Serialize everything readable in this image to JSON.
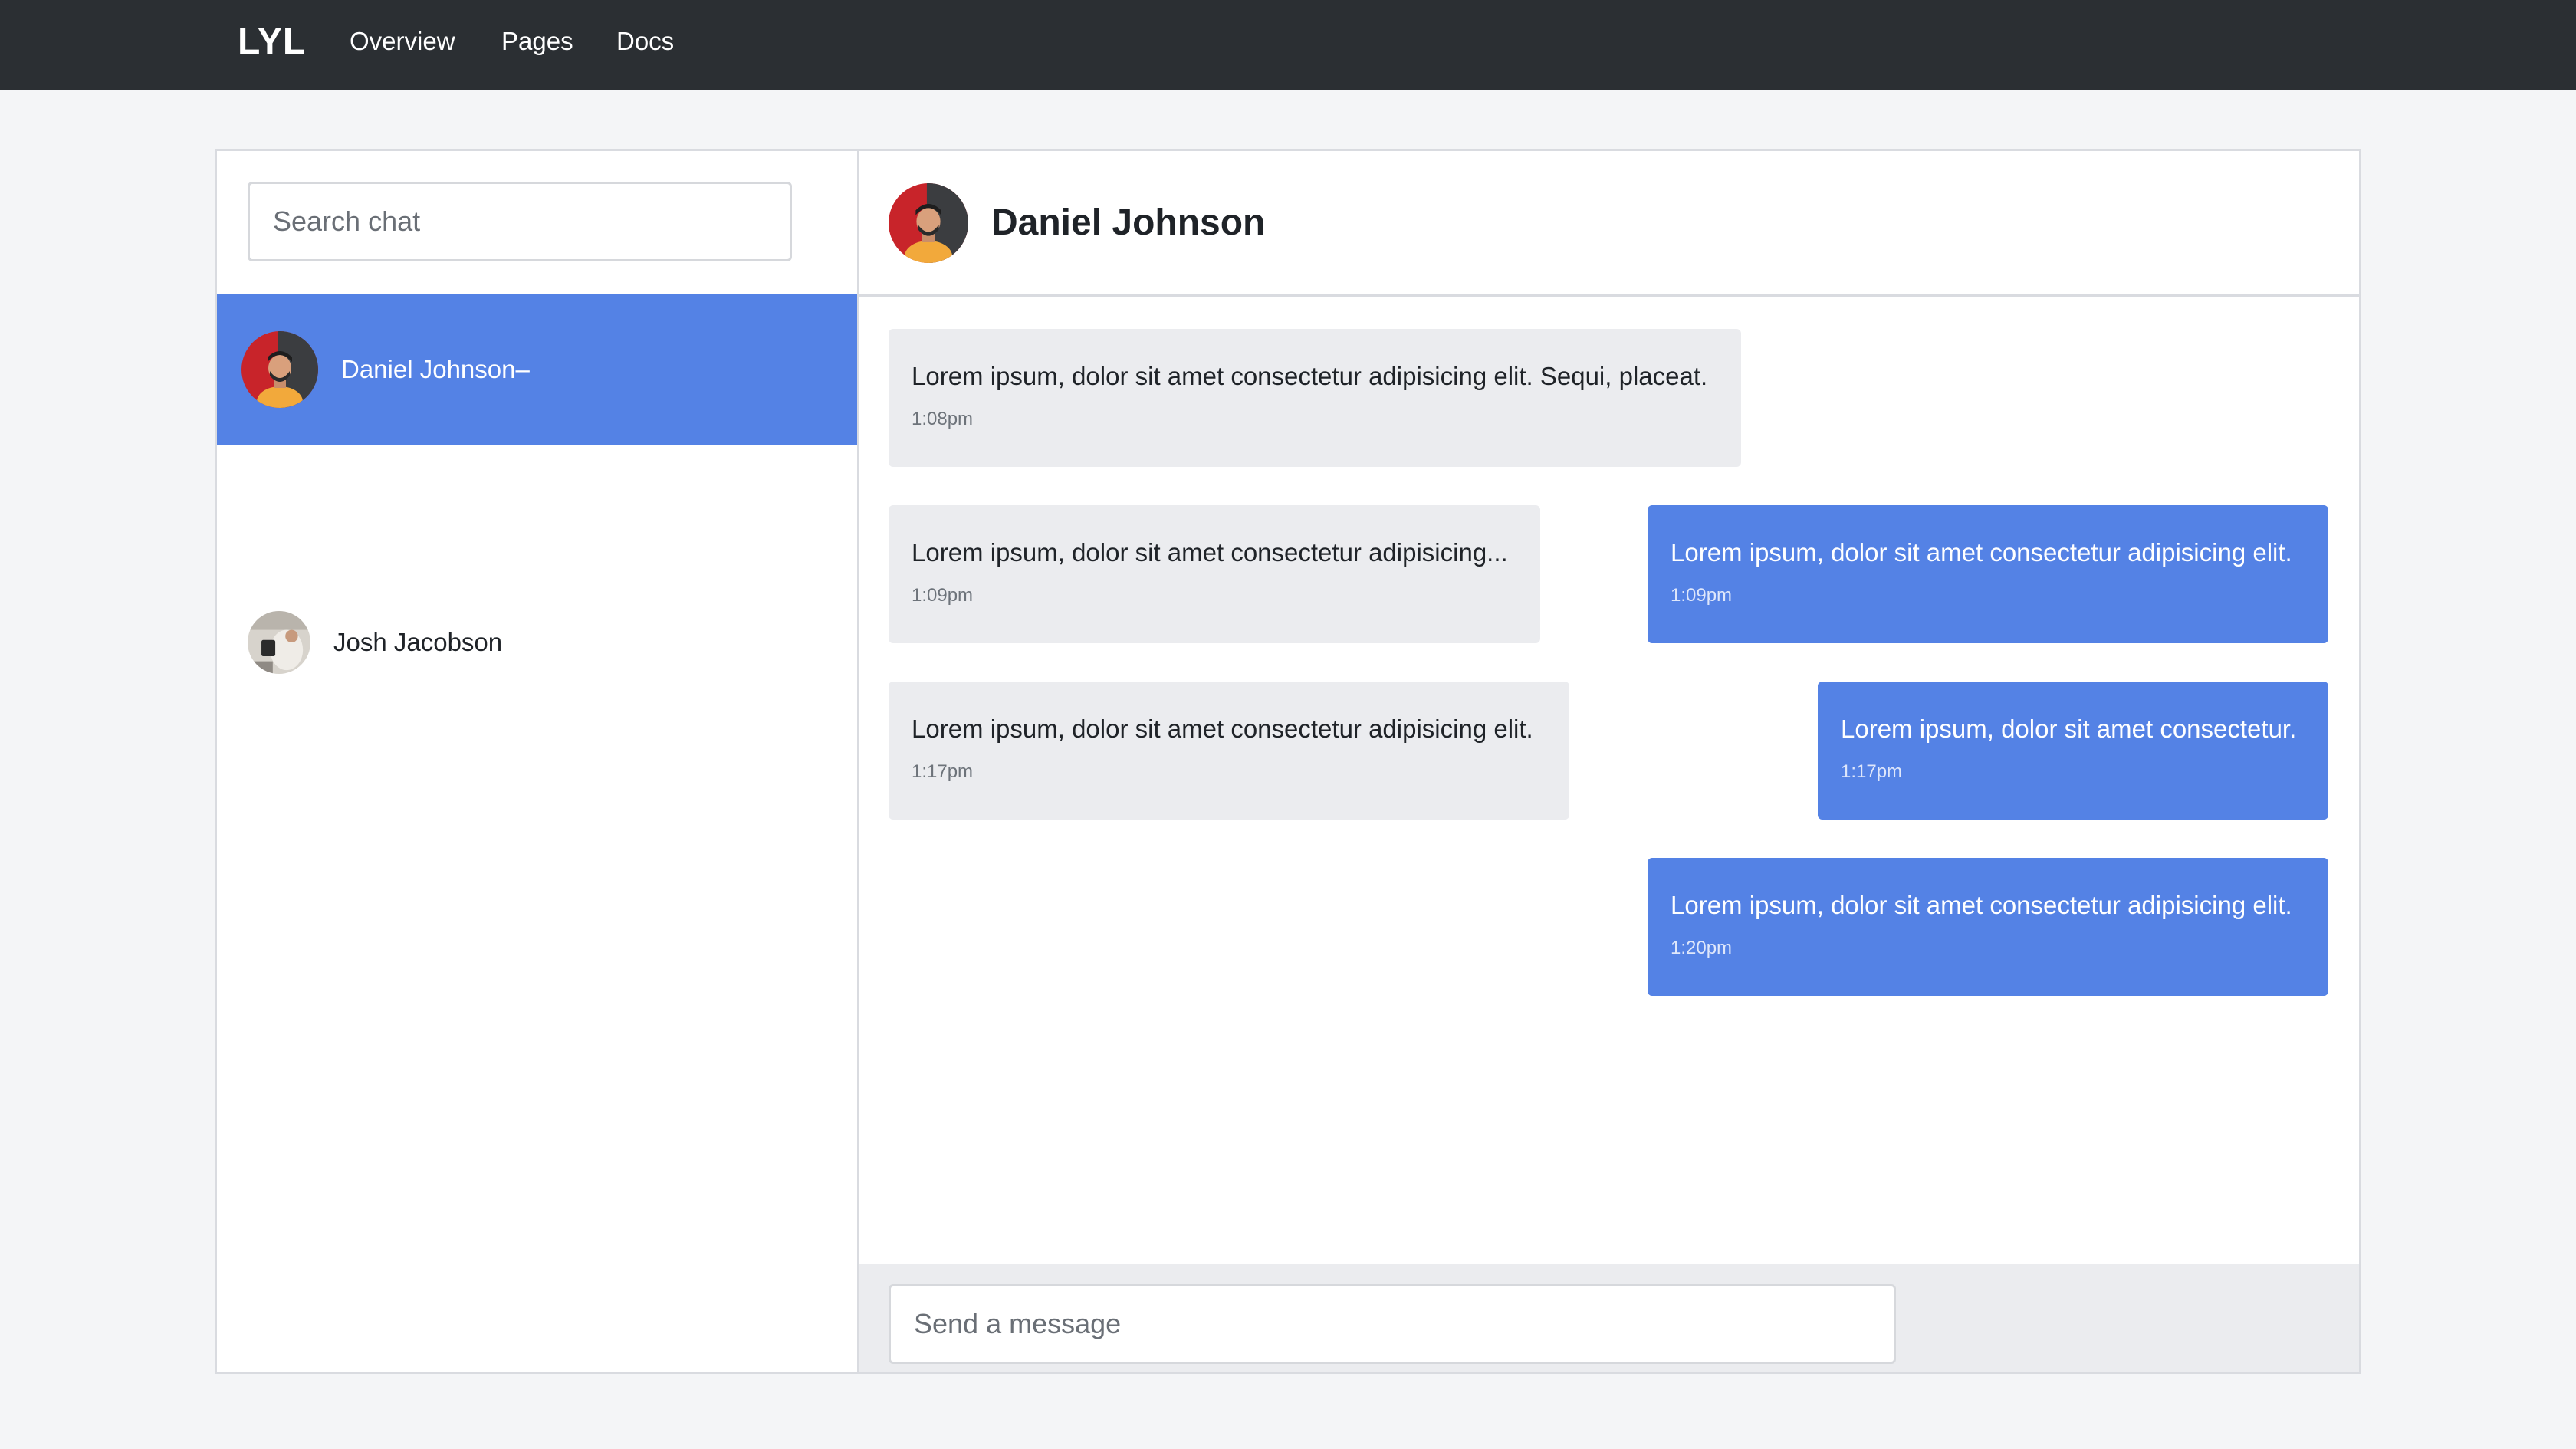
{
  "navbar": {
    "brand": "LYL",
    "links": [
      "Overview",
      "Pages",
      "Docs"
    ]
  },
  "sidebar": {
    "search_placeholder": "Search chat",
    "contacts": [
      {
        "name": "Daniel Johnson–",
        "active": true
      },
      {
        "name": "Josh Jacobson",
        "active": false
      }
    ]
  },
  "chat": {
    "title": "Daniel Johnson",
    "messages": [
      {
        "direction": "in",
        "text": "Lorem ipsum, dolor sit amet consectetur adipisicing elit. Sequi, placeat.",
        "time": "1:08pm"
      },
      {
        "direction": "in",
        "text": "Lorem ipsum, dolor sit amet consectetur adipisicing...",
        "time": "1:09pm"
      },
      {
        "direction": "out",
        "text": "Lorem ipsum, dolor sit amet consectetur adipisicing elit.",
        "time": "1:09pm"
      },
      {
        "direction": "in",
        "text": "Lorem ipsum, dolor sit amet consectetur adipisicing elit.",
        "time": "1:17pm"
      },
      {
        "direction": "out",
        "text": "Lorem ipsum, dolor sit amet consectetur.",
        "time": "1:17pm"
      },
      {
        "direction": "out",
        "text": "Lorem ipsum, dolor sit amet consectetur adipisicing elit.",
        "time": "1:20pm"
      }
    ],
    "composer_placeholder": "Send a message"
  },
  "colors": {
    "navbar": "#2b2f33",
    "accent": "#5482e5",
    "incoming_bubble": "#ebecef",
    "page_bg": "#f4f5f7"
  }
}
